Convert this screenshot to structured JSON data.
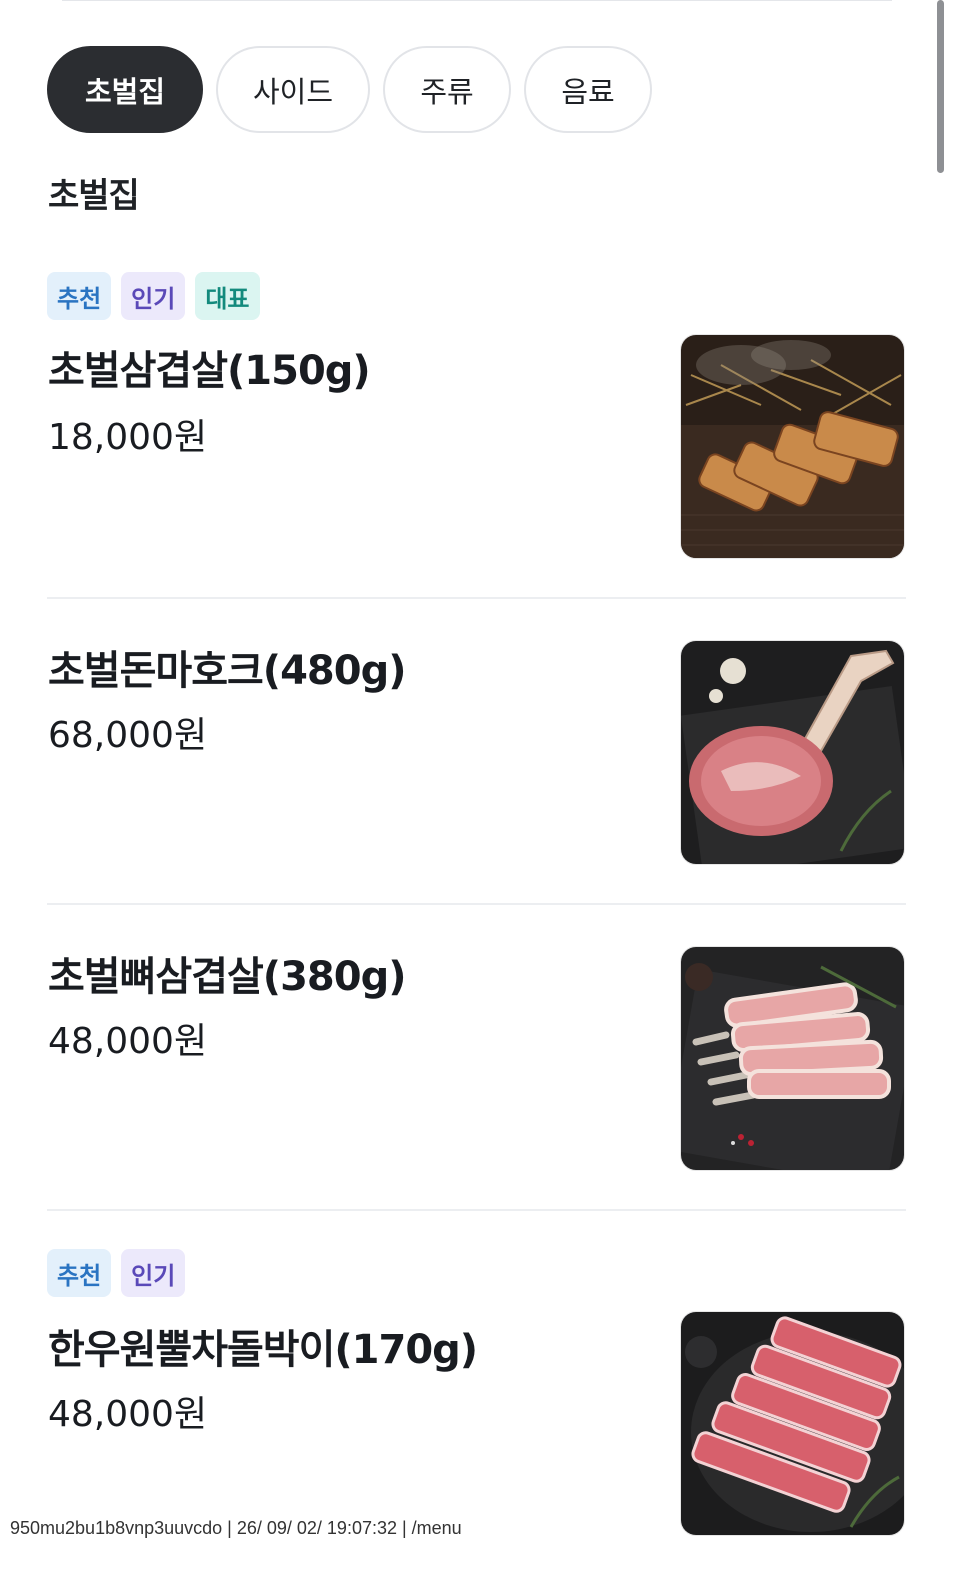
{
  "tabs": [
    {
      "label": "초벌집",
      "active": true
    },
    {
      "label": "사이드",
      "active": false
    },
    {
      "label": "주류",
      "active": false
    },
    {
      "label": "음료",
      "active": false
    }
  ],
  "section_title": "초벌집",
  "items": [
    {
      "badges": [
        {
          "text": "추천",
          "color": "blue"
        },
        {
          "text": "인기",
          "color": "purple"
        },
        {
          "text": "대표",
          "color": "teal"
        }
      ],
      "name": "초벌삼겹살(150g)",
      "price": "18,000원",
      "image": "grilled-pork-belly-photo"
    },
    {
      "badges": [],
      "name": "초벌돈마호크(480g)",
      "price": "68,000원",
      "image": "tomahawk-pork-photo"
    },
    {
      "badges": [],
      "name": "초벌뼈삼겹살(380g)",
      "price": "48,000원",
      "image": "bone-in-pork-belly-photo"
    },
    {
      "badges": [
        {
          "text": "추천",
          "color": "blue"
        },
        {
          "text": "인기",
          "color": "purple"
        }
      ],
      "name": "한우원뿔차돌박이(170g)",
      "price": "48,000원",
      "image": "sliced-beef-brisket-photo"
    }
  ],
  "footer": "950mu2bu1b8vnp3uuvcdo | 26/ 09/ 02/ 19:07:32 | /menu",
  "colors": {
    "active_tab": "#2b2d31",
    "badge_blue": "#2a74c2",
    "badge_purple": "#5a49b8",
    "badge_teal": "#138a7d"
  }
}
